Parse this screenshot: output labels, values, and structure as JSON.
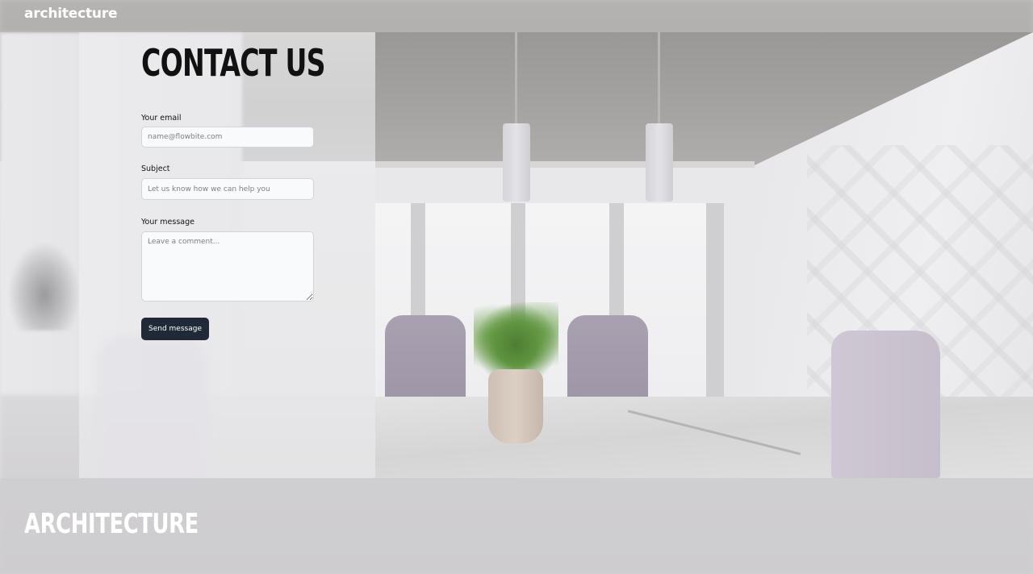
{
  "header": {
    "brand": "architecture"
  },
  "contact": {
    "title": "CONTACT US",
    "email": {
      "label": "Your email",
      "placeholder": "name@flowbite.com",
      "value": ""
    },
    "subject": {
      "label": "Subject",
      "placeholder": "Let us know how we can help you",
      "value": ""
    },
    "message": {
      "label": "Your message",
      "placeholder": "Leave a comment...",
      "value": ""
    },
    "submit_label": "Send message"
  },
  "footer": {
    "brand": "ARCHITECTURE"
  },
  "colors": {
    "button_bg": "#1f2937",
    "button_text": "#ffffff",
    "input_bg": "#f9fafb",
    "input_border": "#d1d5db",
    "heading": "#111111",
    "brand_text": "#ffffff"
  },
  "background_image": "interior photo of a dining room with marble table, lilac chairs, potted plant in vase and pendant lamps"
}
